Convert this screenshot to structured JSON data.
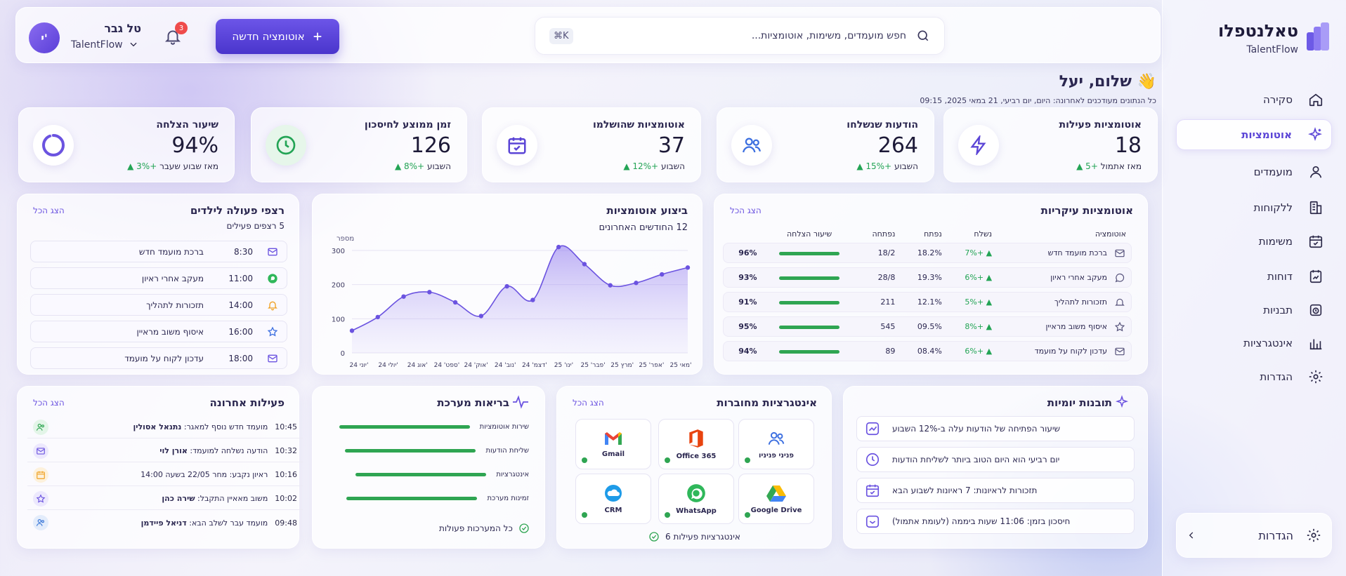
{
  "app": {
    "title": "טאלנטפלו",
    "subtitle": "TalentFlow"
  },
  "sidebar": {
    "items": [
      {
        "label": "סקירה",
        "icon": "home-icon"
      },
      {
        "label": "אוטומציות",
        "icon": "sparkle-icon",
        "active": true
      },
      {
        "label": "מועמדים",
        "icon": "user-icon"
      },
      {
        "label": "ללקוחות",
        "icon": "building-icon"
      },
      {
        "label": "משימות",
        "icon": "calendar-check-icon"
      },
      {
        "label": "דוחות",
        "icon": "report-icon"
      },
      {
        "label": "תבניות",
        "icon": "template-icon"
      },
      {
        "label": "אינטגרציות",
        "icon": "chart-icon"
      },
      {
        "label": "הגדרות",
        "icon": "gear-icon"
      }
    ],
    "settings_card": {
      "label": "הגדרות"
    }
  },
  "topbar": {
    "search_placeholder": "חפש מועמדים, משימות, אוטומציות...",
    "shortcut": "⌘K",
    "new_button": "אוטומציה חדשה",
    "notifications": "3",
    "user_name": "טל גבר",
    "user_org": "TalentFlow",
    "avatar_initial": "י'"
  },
  "greeting": {
    "title": "שלום, יעל",
    "emoji": "👋",
    "subtitle": "כל הנתונים מעודכנים לאחרונה: היום, יום רביעי, 21 במאי 2025, 09:15"
  },
  "stats": [
    {
      "label": "אוטומציות פעילות",
      "value": "18",
      "change": "+5",
      "suffix": "מאז אתמול",
      "icon": "bolt-icon"
    },
    {
      "label": "הודעות שנשלחו",
      "value": "264",
      "change": "+15%",
      "suffix": "השבוע",
      "icon": "users-icon"
    },
    {
      "label": "אוטומציות שהושלמו",
      "value": "37",
      "change": "+12%",
      "suffix": "השבוע",
      "icon": "calendar-icon"
    },
    {
      "label": "זמן ממוצע לחיסכון",
      "value": "126",
      "change": "+8%",
      "suffix": "השבוע",
      "icon": "clock-icon"
    },
    {
      "label": "שיעור הצלחה",
      "value": "94%",
      "change": "+3%",
      "suffix": "מאז שבוע שעבר",
      "icon": "ring-icon"
    }
  ],
  "top_automations": {
    "title": "אוטומציות עיקריות",
    "link": "הצג הכל",
    "headers": [
      "אוטומציה",
      "נשלח",
      "נפתח",
      "נפתחה",
      "שיעור הצלחה"
    ],
    "rows": [
      {
        "name": "ברכת מועמד חדש",
        "sent": "+7%",
        "opened": "18.2%",
        "count": "18/2",
        "rate": "96%",
        "icon": "mail-icon"
      },
      {
        "name": "מעקב אחרי ראיון",
        "sent": "+6%",
        "opened": "19.3%",
        "count": "28/8",
        "rate": "93%",
        "icon": "whatsapp-icon"
      },
      {
        "name": "תזכורות לתהליך",
        "sent": "+5%",
        "opened": "12.1%",
        "count": "211",
        "rate": "91%",
        "icon": "bell-icon"
      },
      {
        "name": "איסוף משוב מראיין",
        "sent": "+8%",
        "opened": "09.5%",
        "count": "545",
        "rate": "95%",
        "icon": "star-icon"
      },
      {
        "name": "עדכון לקוח על מועמד",
        "sent": "+6%",
        "opened": "08.4%",
        "count": "89",
        "rate": "94%",
        "icon": "mail-icon"
      }
    ]
  },
  "performance": {
    "title": "ביצוע אוטומציות",
    "subtitle": "12 החודשים האחרונים"
  },
  "chart_data": {
    "type": "area",
    "title": "ביצוע אוטומציות",
    "subtitle": "12 החודשים האחרונים",
    "ylabel": "מספר",
    "ylim": [
      0,
      300
    ],
    "yticks": [
      "0",
      "100",
      "200",
      "300"
    ],
    "x": [
      "יוני 24'",
      "יולי 24'",
      "אוג 24'",
      "ספט' 24'",
      "אוק' 24'",
      "נוב' 24'",
      "דצמ' 24'",
      "ינו' 25'",
      "פבר' 25'",
      "מרץ 25'",
      "אפר' 25'",
      "מאי 25'"
    ],
    "values": [
      65,
      105,
      165,
      178,
      148,
      108,
      195,
      155,
      310,
      260,
      198,
      205,
      230,
      250
    ],
    "series": [
      {
        "name": "",
        "values": [
          65,
          105,
          165,
          178,
          148,
          108,
          195,
          155,
          310,
          260,
          198,
          205,
          230,
          250
        ]
      }
    ]
  },
  "sequences": {
    "title": "רצפי פעולה לילדים",
    "link": "הצג הכל",
    "subtitle": "5 רצפים פעילים",
    "rows": [
      {
        "time": "8:30",
        "name": "ברכת מועמד חדש",
        "icon": "mail-icon"
      },
      {
        "time": "11:00",
        "name": "מעקב אחרי ראיון",
        "icon": "whatsapp-icon"
      },
      {
        "time": "14:00",
        "name": "תזכורות לתהליך",
        "icon": "bell-icon"
      },
      {
        "time": "16:00",
        "name": "איסוף משוב מראיין",
        "icon": "star-icon"
      },
      {
        "time": "18:00",
        "name": "עדכון לקוח על מועמד",
        "icon": "mail-icon"
      }
    ]
  },
  "activity": {
    "title": "פעילות אחרונה",
    "link": "הצג הכל",
    "rows": [
      {
        "pre": "מועמד חדש נוסף למאגר: ",
        "bold": "נתנאל אסולין",
        "time": "10:45",
        "icon": "users-icon",
        "color": "#2fa552"
      },
      {
        "pre": "הודעה נשלחה למועמד: ",
        "bold": "אורן לוי",
        "time": "10:32",
        "icon": "mail-icon",
        "color": "#6b53e0"
      },
      {
        "pre": "ראיון נקבע: מחר 22/05 בשעה 14:00",
        "bold": "",
        "time": "10:16",
        "icon": "calendar-icon",
        "color": "#f0a020"
      },
      {
        "pre": "משוב מאאיין התקבל: ",
        "bold": "שירה כהן",
        "time": "10:02",
        "icon": "star-icon",
        "color": "#6b53e0"
      },
      {
        "pre": "מועמד עבר לשלב הבא: ",
        "bold": "דניאל פיידמן",
        "time": "09:48",
        "icon": "users-icon",
        "color": "#3c78d8"
      }
    ]
  },
  "health": {
    "title": "בריאות מערכת",
    "rows": [
      "שירות אוטומציות",
      "שליחת הודעות",
      "אינטגרציות",
      "זמינות מערכת"
    ],
    "footer": "כל המערכות פעולות"
  },
  "integrations": {
    "title": "אינטגרציות מחוברות",
    "link": "הצג הכל",
    "tiles": [
      {
        "name": "פניני פניניו",
        "icon": "people-icon"
      },
      {
        "name": "Office 365",
        "icon": "office-icon"
      },
      {
        "name": "Gmail",
        "icon": "gmail-icon"
      },
      {
        "name": "Google Drive",
        "icon": "drive-icon"
      },
      {
        "name": "WhatsApp",
        "icon": "whatsapp-icon"
      },
      {
        "name": "CRM",
        "icon": "cloud-icon"
      }
    ],
    "footer": "6 אינטגרציות פעילות"
  },
  "insights": {
    "title": "תובנות יומיות",
    "rows": [
      {
        "text": "שיעור הפתיחה של הודעות עלה ב-12% השבוע",
        "icon": "trend-icon"
      },
      {
        "text": "יום רביעי הוא היום הטוב ביותר לשליחת הודעות",
        "icon": "clock-icon"
      },
      {
        "text": "תזכורות לראיונות: 7 ראיונות לשבוע הבא",
        "icon": "calendar-icon"
      },
      {
        "text": "חיסכון בזמן: 11:06 שעות ביממה (לעומת אתמול)",
        "icon": "savings-icon"
      }
    ]
  },
  "colors": {
    "accent": "#5b45d6",
    "success": "#2fa552",
    "danger": "#ef4b4b"
  }
}
